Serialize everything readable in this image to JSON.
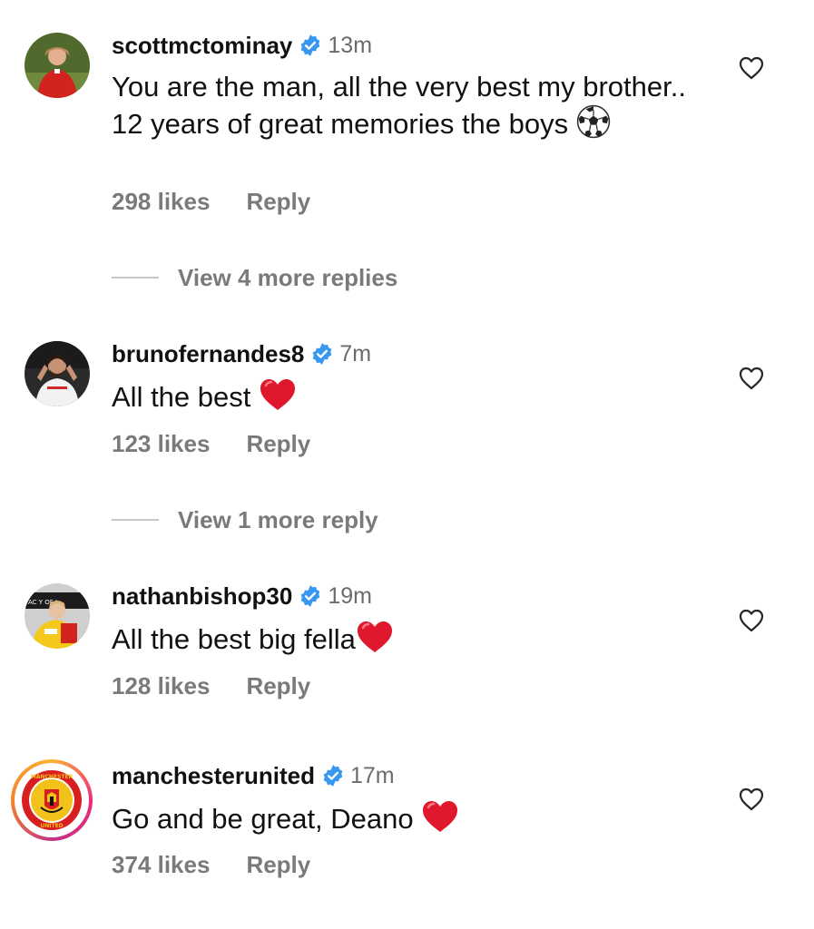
{
  "comments": [
    {
      "username": "scottmctominay",
      "time": "13m",
      "text": "You are the man, all the very best my brother.. 12 years of great memories the boys",
      "emoji": "soccer-ball",
      "likes": "298 likes",
      "reply": "Reply",
      "avatar_icon": "player-avatar"
    },
    {
      "username": "brunofernandes8",
      "time": "7m",
      "text": "All the best",
      "emoji": "red-heart",
      "likes": "123 likes",
      "reply": "Reply",
      "avatar_icon": "player-avatar"
    },
    {
      "username": "nathanbishop30",
      "time": "19m",
      "text": "All the best big fella",
      "emoji": "red-heart",
      "likes": "128 likes",
      "reply": "Reply",
      "avatar_icon": "player-avatar"
    },
    {
      "username": "manchesterunited",
      "time": "17m",
      "text": "Go and be great, Deano",
      "emoji": "red-heart",
      "likes": "374 likes",
      "reply": "Reply",
      "avatar_icon": "club-crest"
    }
  ],
  "view_more": [
    "View 4 more replies",
    "View 1 more reply"
  ],
  "colors": {
    "verified": "#3897f0",
    "muted_text": "#7a7a7a",
    "heart_red": "#e0182d"
  }
}
